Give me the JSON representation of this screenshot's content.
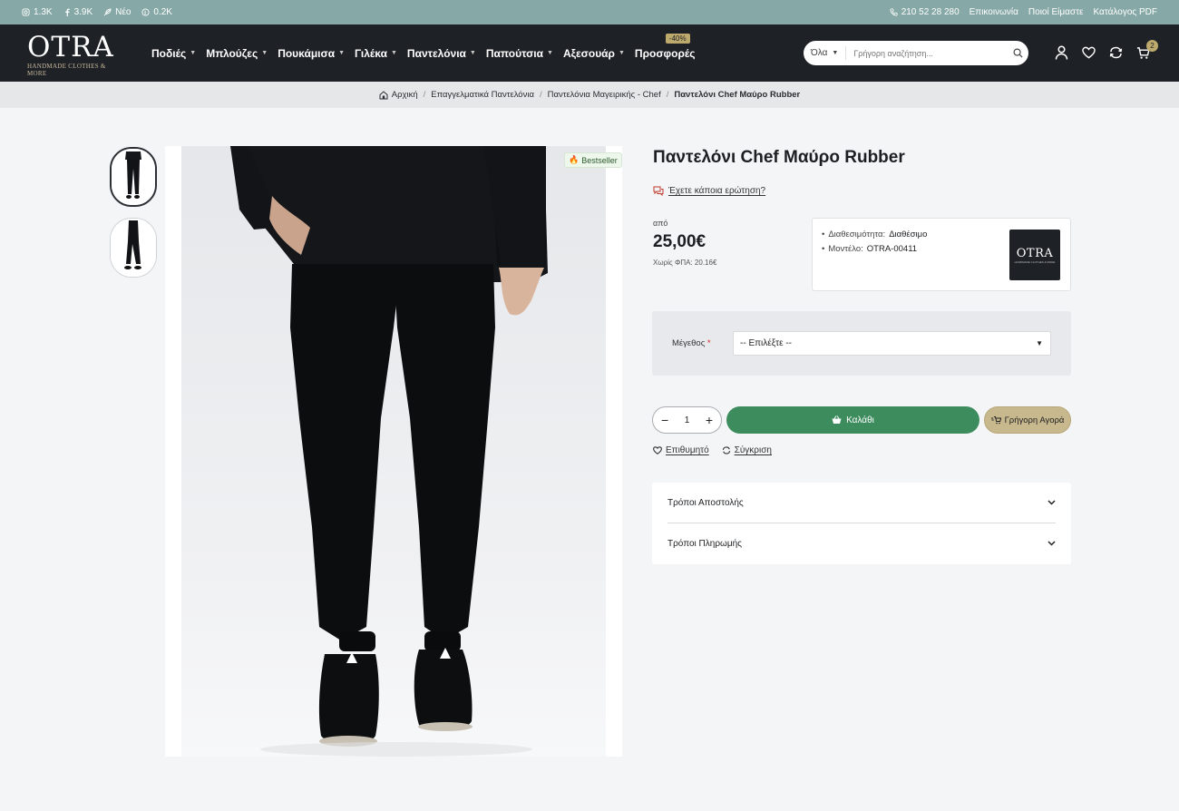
{
  "topbar": {
    "social": [
      {
        "icon": "instagram-icon",
        "count": "1.3K"
      },
      {
        "icon": "facebook-icon",
        "count": "3.9K"
      },
      {
        "icon": "feather-icon",
        "count": "Νέο"
      },
      {
        "icon": "pinterest-icon",
        "count": "0.2K"
      }
    ],
    "phone": "210 52 28 280",
    "links": [
      "Επικοινωνία",
      "Ποιοί Είμαστε",
      "Κατάλογος PDF"
    ]
  },
  "header": {
    "logo": "OTRA",
    "tagline": "HANDMADE CLOTHES & MORE",
    "nav": [
      "Ποδιές",
      "Μπλούζες",
      "Πουκάμισα",
      "Γιλέκα",
      "Παντελόνια",
      "Παπούτσια",
      "Αξεσουάρ",
      "Προσφορές"
    ],
    "discount_badge": "-40%",
    "search": {
      "category": "Όλα",
      "placeholder": "Γρήγορη αναζήτηση..."
    },
    "cart_count": "2"
  },
  "breadcrumb": [
    "Αρχική",
    "Επαγγελματικά Παντελόνια",
    "Παντελόνια Μαγειρικής - Chef",
    "Παντελόνι Chef Μαύρο Rubber"
  ],
  "product": {
    "badge": "Bestseller",
    "title": "Παντελόνι Chef Μαύρο Rubber",
    "question": "Έχετε κάποια ερώτηση?",
    "price_prefix": "από",
    "price": "25,00€",
    "vat_line": "Χωρίς ΦΠΑ: 20.16€",
    "availability_label": "Διαθεσιμότητα:",
    "availability_value": "Διαθέσιμο",
    "model_label": "Μοντέλο:",
    "model_value": "OTRA-00411",
    "brand_logo": "OTRA"
  },
  "options": {
    "size_label": "Μέγεθος",
    "required_mark": "*",
    "size_value": "-- Επιλέξτε --"
  },
  "purchase": {
    "quantity": "1",
    "minus": "−",
    "plus": "+",
    "add_to_cart": "Καλάθι",
    "quick_buy": "Γρήγορη Αγορά",
    "wishlist": "Επιθυμητό",
    "compare": "Σύγκριση"
  },
  "accordion": [
    "Τρόποι Αποστολής",
    "Τρόποι Πληρωμής"
  ],
  "colors": {
    "topbar": "#86a8a6",
    "header": "#1e2226",
    "cart_button": "#3d8c5e",
    "quick_buy": "#c8b88e",
    "accent": "#bda96c"
  }
}
